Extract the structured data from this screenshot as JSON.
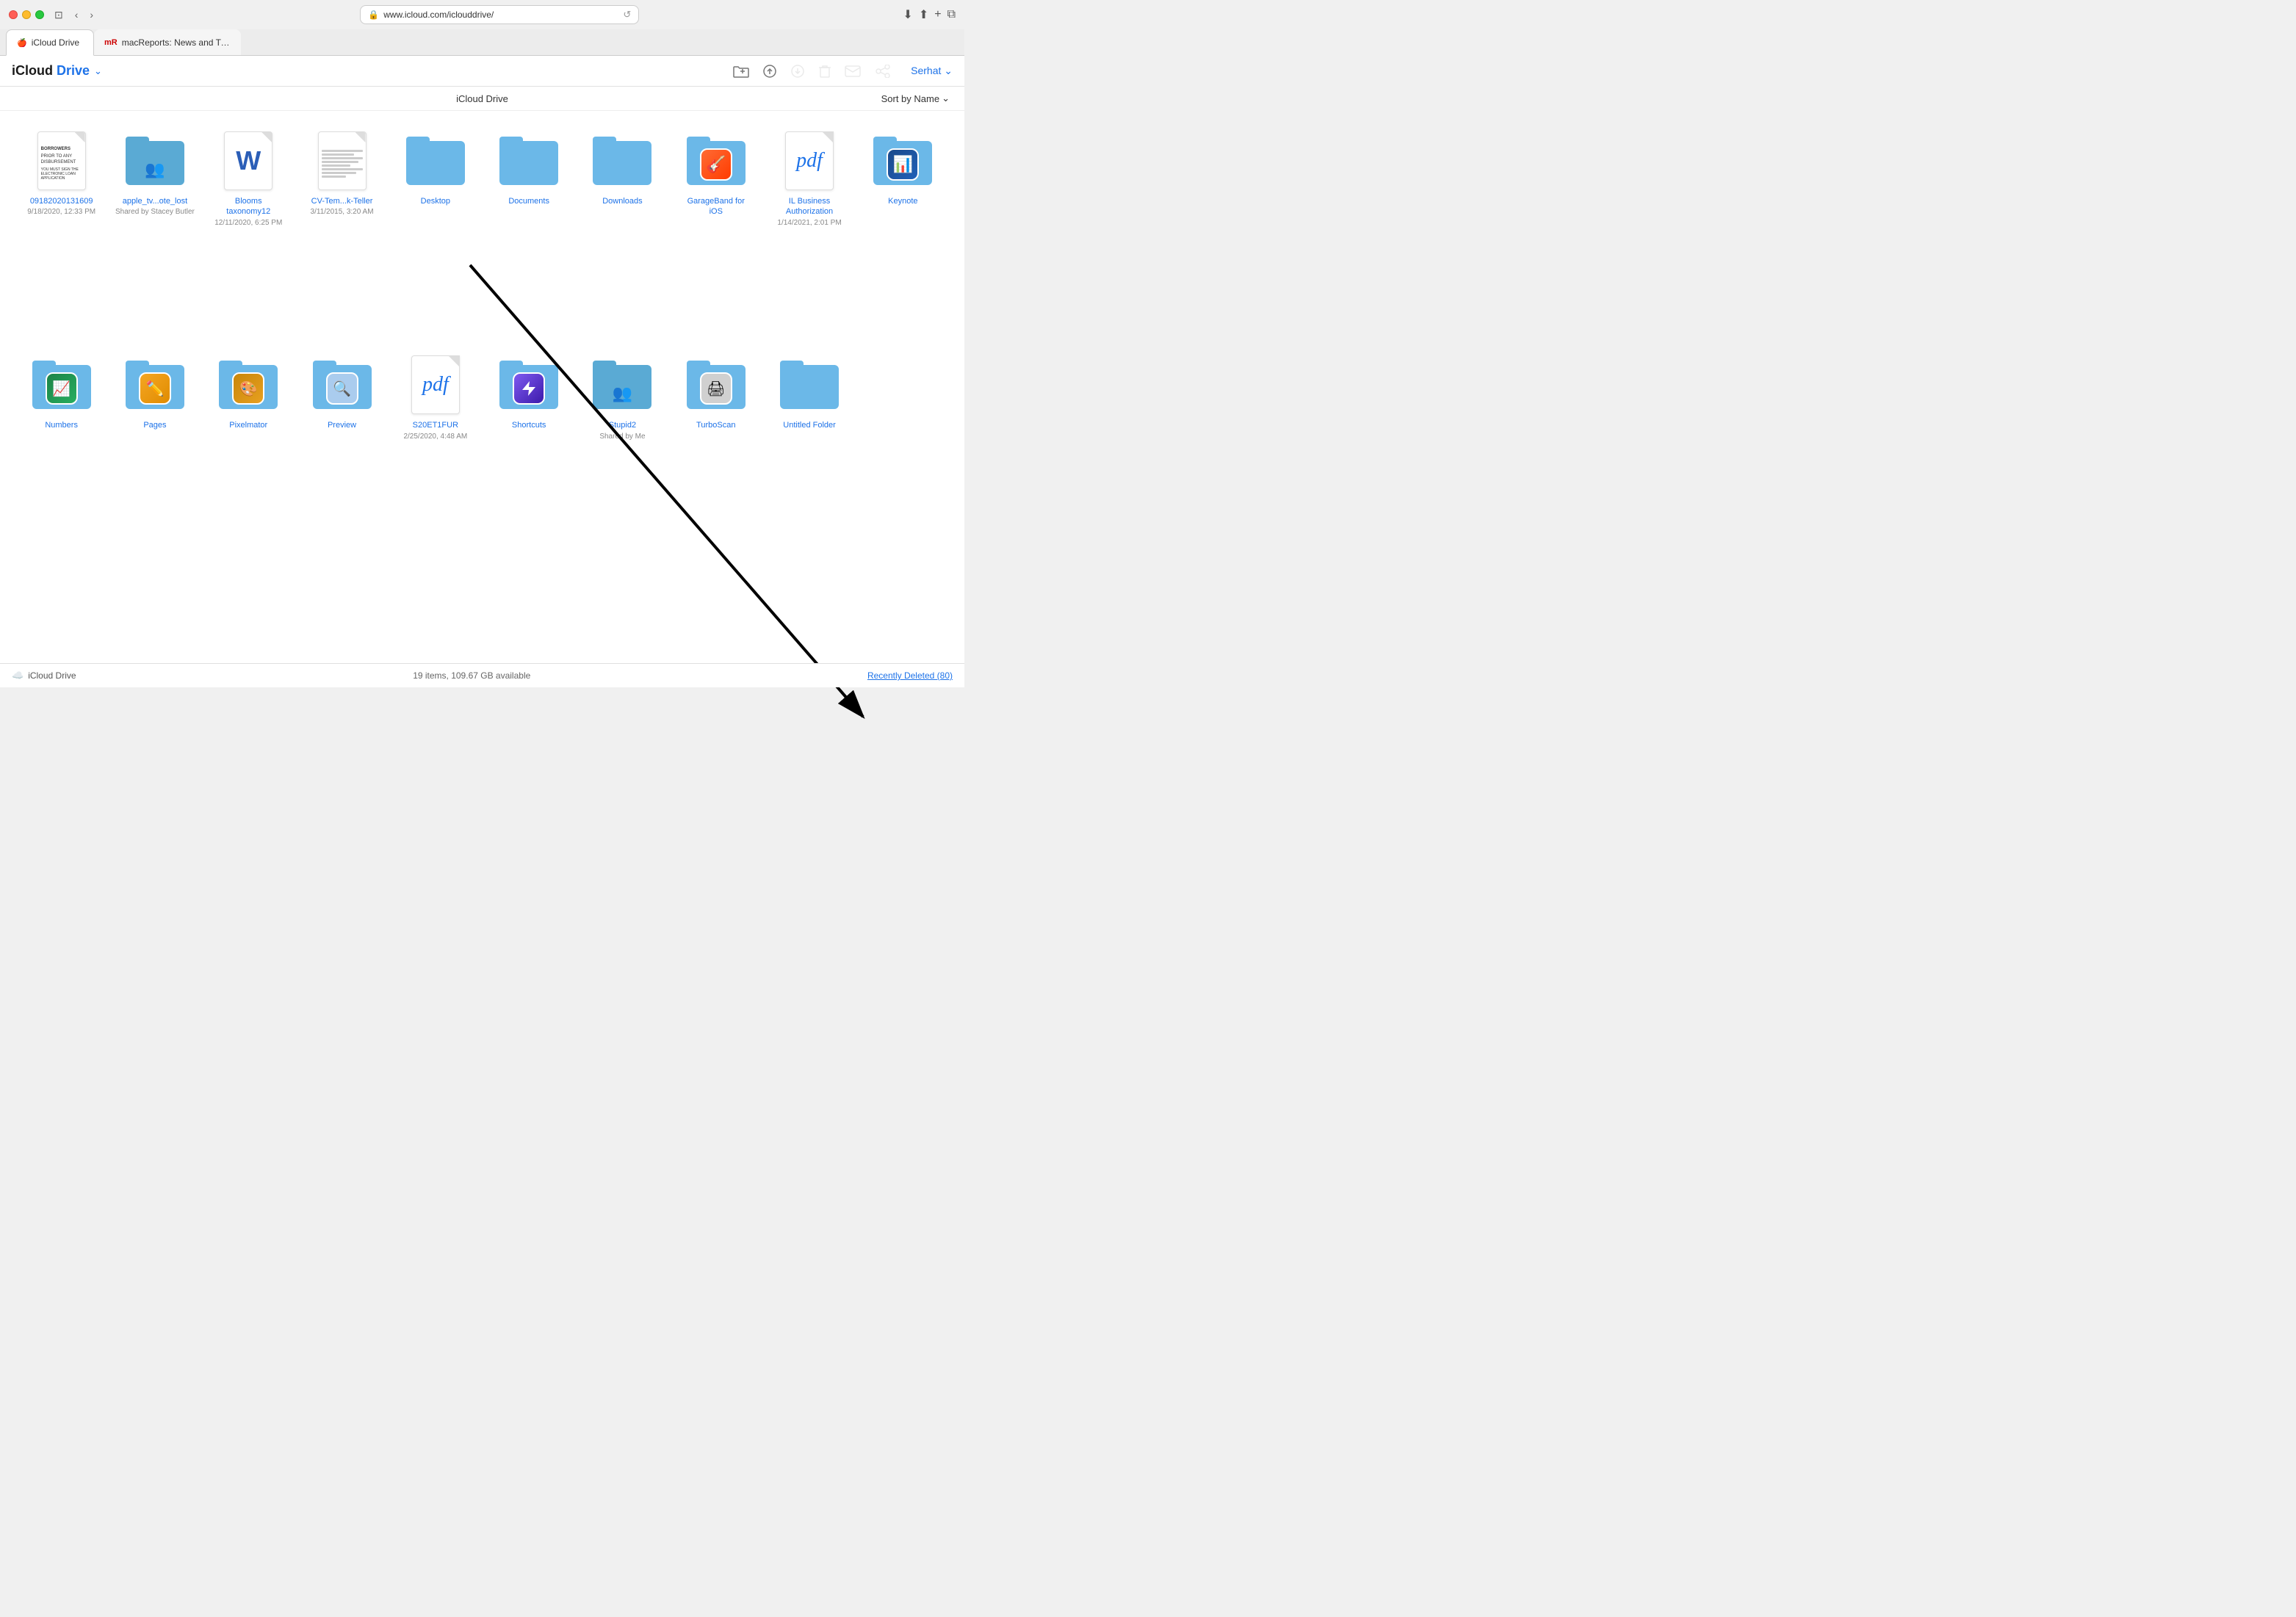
{
  "browser": {
    "url": "www.icloud.com/iclouddrive/",
    "tab1_label": "iCloud Drive",
    "tab2_label": "macReports: News and Tips for Mac, iPhone, iPad, and All things Apple",
    "back_disabled": false,
    "forward_disabled": false
  },
  "toolbar": {
    "title": "iCloud",
    "title_drive": "Drive",
    "chevron": "˅",
    "user_label": "Serhat",
    "sort_label": "Sort by Name"
  },
  "subheader": {
    "title": "iCloud Drive"
  },
  "files": [
    {
      "id": "file-09182020131609",
      "type": "doc",
      "name": "09182020131609",
      "date": "9/18/2020, 12:33 PM",
      "subtitle": ""
    },
    {
      "id": "folder-apple-tv",
      "type": "folder-shared",
      "name": "apple_tv...ote_lost",
      "date": "",
      "subtitle": "Shared by Stacey Butler"
    },
    {
      "id": "file-blooms",
      "type": "word",
      "name": "Blooms taxonomy12",
      "date": "12/11/2020, 6:25 PM",
      "subtitle": ""
    },
    {
      "id": "file-cv-tem",
      "type": "doc-text",
      "name": "CV-Tem...k-Teller",
      "date": "3/11/2015, 3:20 AM",
      "subtitle": ""
    },
    {
      "id": "folder-desktop",
      "type": "folder",
      "name": "Desktop",
      "date": "",
      "subtitle": ""
    },
    {
      "id": "folder-documents",
      "type": "folder",
      "name": "Documents",
      "date": "",
      "subtitle": ""
    },
    {
      "id": "folder-downloads",
      "type": "folder",
      "name": "Downloads",
      "date": "",
      "subtitle": ""
    },
    {
      "id": "folder-garageband",
      "type": "app-folder",
      "name": "GarageBand for iOS",
      "date": "",
      "subtitle": ""
    },
    {
      "id": "file-il-business",
      "type": "pdf",
      "name": "IL Business Authorization",
      "date": "1/14/2021, 2:01 PM",
      "subtitle": ""
    },
    {
      "id": "folder-keynote",
      "type": "app-folder-keynote",
      "name": "Keynote",
      "date": "",
      "subtitle": ""
    },
    {
      "id": "folder-numbers",
      "type": "app-folder-numbers",
      "name": "Numbers",
      "date": "",
      "subtitle": ""
    },
    {
      "id": "folder-pages",
      "type": "app-folder-pages",
      "name": "Pages",
      "date": "",
      "subtitle": ""
    },
    {
      "id": "folder-pixelmator",
      "type": "app-folder-pixelmator",
      "name": "Pixelmator",
      "date": "",
      "subtitle": ""
    },
    {
      "id": "folder-preview",
      "type": "folder-preview",
      "name": "Preview",
      "date": "",
      "subtitle": ""
    },
    {
      "id": "file-s20et1fur",
      "type": "pdf-blue",
      "name": "S20ET1FUR",
      "date": "2/25/2020, 4:48 AM",
      "subtitle": ""
    },
    {
      "id": "folder-shortcuts",
      "type": "app-folder-shortcuts",
      "name": "Shortcuts",
      "date": "",
      "subtitle": ""
    },
    {
      "id": "folder-stupid2",
      "type": "folder-shared-me",
      "name": "Stupid2",
      "date": "",
      "subtitle": "Shared by Me"
    },
    {
      "id": "folder-turboscan",
      "type": "app-folder-turboscan",
      "name": "TurboScan",
      "date": "",
      "subtitle": ""
    },
    {
      "id": "folder-untitled",
      "type": "folder",
      "name": "Untitled Folder",
      "date": "",
      "subtitle": ""
    }
  ],
  "statusbar": {
    "icloud_label": "iCloud Drive",
    "info": "19 items, 109.67 GB available",
    "recently_deleted": "Recently Deleted (80)"
  }
}
